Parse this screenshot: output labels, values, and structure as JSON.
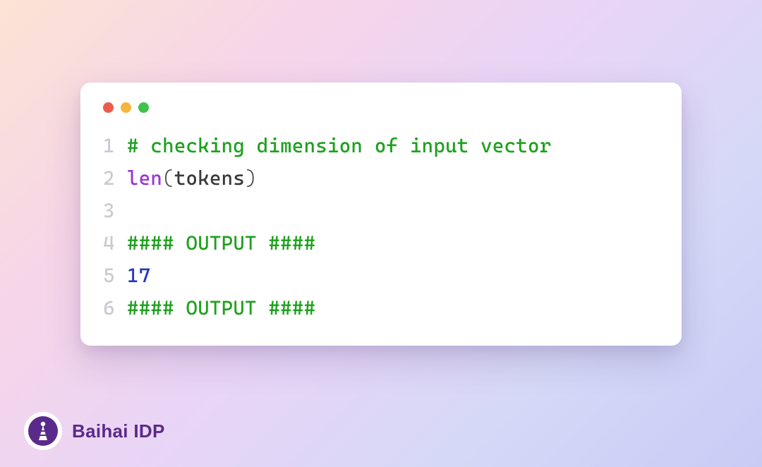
{
  "code": {
    "lines": [
      {
        "num": "1",
        "segments": [
          {
            "cls": "tok-comment",
            "text": "# checking dimension of input vector"
          }
        ]
      },
      {
        "num": "2",
        "segments": [
          {
            "cls": "tok-builtin",
            "text": "len"
          },
          {
            "cls": "tok-punct",
            "text": "("
          },
          {
            "cls": "tok-ident",
            "text": "tokens"
          },
          {
            "cls": "tok-punct",
            "text": ")"
          }
        ]
      },
      {
        "num": "3",
        "segments": []
      },
      {
        "num": "4",
        "segments": [
          {
            "cls": "tok-comment",
            "text": "#### OUTPUT ####"
          }
        ]
      },
      {
        "num": "5",
        "segments": [
          {
            "cls": "tok-number",
            "text": "17"
          }
        ]
      },
      {
        "num": "6",
        "segments": [
          {
            "cls": "tok-comment",
            "text": "#### OUTPUT ####"
          }
        ]
      }
    ]
  },
  "branding": {
    "text": "Baihai IDP"
  },
  "traffic_lights": {
    "red": "close",
    "yellow": "minimize",
    "green": "maximize"
  }
}
